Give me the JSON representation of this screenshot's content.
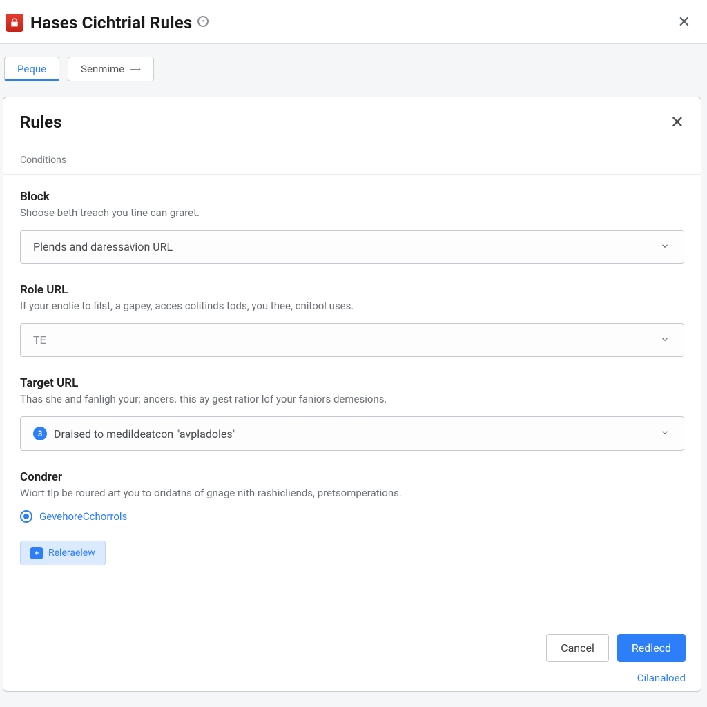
{
  "header": {
    "title": "Hases Cichtrial Rules"
  },
  "tabs": {
    "active": "Peque",
    "secondary": "Senmime"
  },
  "panel": {
    "title": "Rules",
    "subheader": "Conditions"
  },
  "block": {
    "label": "Block",
    "help": "Shoose beth treach you tine can graret.",
    "value": "Plends and daressavion URL"
  },
  "role": {
    "label": "Role URL",
    "help": "If your enolie to filst, a gapey, acces colitinds tods, you thee, cnitool uses.",
    "value": "TE"
  },
  "target": {
    "label": "Target URL",
    "help": "Thas she and fanligh your; ancers. this ay gest ratior lof your faniors demesions.",
    "badge": "3",
    "value": "Draised to medildeatcon \"avpladoles\""
  },
  "condrer": {
    "label": "Condrer",
    "help": "Wiort tlp be roured art you to oridatns of gnage nith rashicliends, pretsomperations.",
    "radio": "GevehoreCchorrols",
    "chip": "Releraelew"
  },
  "footer": {
    "cancel": "Cancel",
    "primary": "Redlecd",
    "link": "Cilanaloed"
  }
}
